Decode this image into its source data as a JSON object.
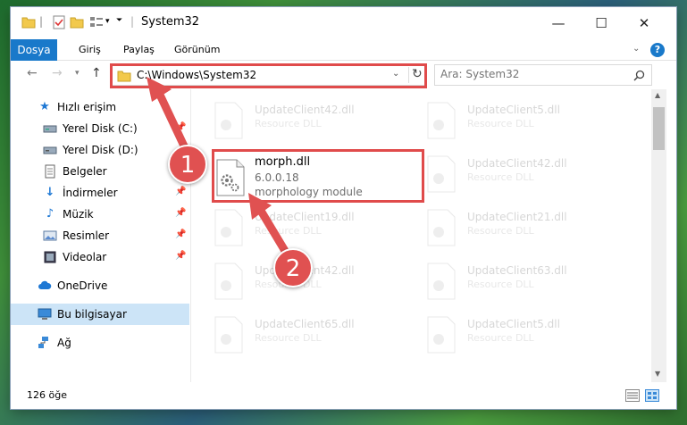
{
  "window": {
    "title": "System32"
  },
  "ribbon": {
    "tabs": [
      "Dosya",
      "Giriş",
      "Paylaş",
      "Görünüm"
    ]
  },
  "nav": {
    "address": "C:\\Windows\\System32",
    "search_placeholder": "Ara: System32"
  },
  "sidebar": {
    "items": [
      {
        "label": "Hızlı erişim",
        "icon": "star-icon",
        "pinned": false
      },
      {
        "label": "Yerel Disk (C:)",
        "icon": "drive-icon",
        "pinned": true
      },
      {
        "label": "Yerel Disk (D:)",
        "icon": "drive-icon",
        "pinned": false
      },
      {
        "label": "Belgeler",
        "icon": "document-icon",
        "pinned": false
      },
      {
        "label": "İndirmeler",
        "icon": "download-icon",
        "pinned": true
      },
      {
        "label": "Müzik",
        "icon": "music-icon",
        "pinned": true
      },
      {
        "label": "Resimler",
        "icon": "pictures-icon",
        "pinned": true
      },
      {
        "label": "Videolar",
        "icon": "video-icon",
        "pinned": true
      },
      {
        "label": "OneDrive",
        "icon": "cloud-icon",
        "pinned": false
      },
      {
        "label": "Bu bilgisayar",
        "icon": "computer-icon",
        "pinned": false,
        "selected": true
      },
      {
        "label": "Ağ",
        "icon": "network-icon",
        "pinned": false
      }
    ]
  },
  "files": {
    "highlighted": {
      "name": "morph.dll",
      "version": "6.0.0.18",
      "description": "morphology module"
    },
    "others": [
      {
        "name": "UpdateClient42.dll",
        "type": "Resource DLL"
      },
      {
        "name": "UpdateClient5.dll",
        "type": "Resource DLL"
      },
      {
        "name": "UpdateClient42.dll",
        "type": "Resource DLL"
      },
      {
        "name": "UpdateClient19.dll",
        "type": "Resource DLL"
      },
      {
        "name": "UpdateClient21.dll",
        "type": "Resource DLL"
      },
      {
        "name": "UpdateClient42.dll",
        "type": "Resource DLL"
      },
      {
        "name": "UpdateClient63.dll",
        "type": "Resource DLL"
      },
      {
        "name": "UpdateClient65.dll",
        "type": "Resource DLL"
      },
      {
        "name": "UpdateClient5.dll",
        "type": "Resource DLL"
      }
    ]
  },
  "status": {
    "count": "126 öğe"
  },
  "callouts": [
    "1",
    "2"
  ],
  "colors": {
    "accent": "#1979ca",
    "highlight": "#e04b4b",
    "selected": "#cce4f7"
  }
}
